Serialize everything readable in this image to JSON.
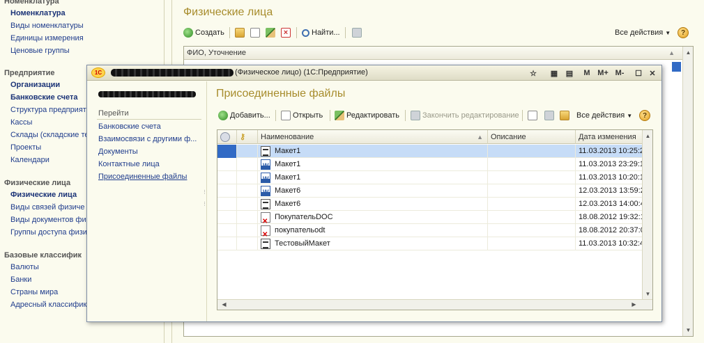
{
  "nav": {
    "groups": [
      {
        "title": "Номенклатура",
        "items": [
          {
            "label": "Номенклатура",
            "bold": true
          },
          {
            "label": "Виды номенклатуры"
          },
          {
            "label": "Единицы измерения"
          },
          {
            "label": "Ценовые группы"
          }
        ]
      },
      {
        "title": "Предприятие",
        "items": [
          {
            "label": "Организации",
            "bold": true
          },
          {
            "label": "Банковские счета",
            "bold": true
          },
          {
            "label": "Структура предприятия"
          },
          {
            "label": "Кассы"
          },
          {
            "label": "Склады (складские те"
          },
          {
            "label": "Проекты"
          },
          {
            "label": "Календари"
          }
        ]
      },
      {
        "title": "Физические лица",
        "items": [
          {
            "label": "Физические лица",
            "bold": true
          },
          {
            "label": "Виды связей физиче"
          },
          {
            "label": "Виды документов физ"
          },
          {
            "label": "Группы доступа физи"
          }
        ]
      },
      {
        "title": "Базовые классифик",
        "items": [
          {
            "label": "Валюты"
          },
          {
            "label": "Банки"
          },
          {
            "label": "Страны мира"
          },
          {
            "label": "Адресный классифик"
          }
        ]
      }
    ]
  },
  "main": {
    "title": "Физические лица",
    "toolbar": {
      "create": "Создать",
      "find": "Найти...",
      "all_actions": "Все действия",
      "help": "?"
    },
    "grid": {
      "column": "ФИО, Уточнение"
    }
  },
  "dialog": {
    "title": "(Физическое лицо) (1С:Предприятие)",
    "logo": "1С",
    "controls": {
      "m": "M",
      "m_plus": "M+",
      "m_minus": "M-"
    },
    "side": {
      "section": "Перейти",
      "links": [
        "Банковские счета",
        "Взаимосвязи с другими ф...",
        "Документы",
        "Контактные лица",
        "Присоединенные файлы"
      ]
    },
    "heading": "Присоединенные файлы",
    "toolbar": {
      "add": "Добавить...",
      "open": "Открыть",
      "edit": "Редактировать",
      "finish_edit": "Закончить редактирование",
      "all_actions": "Все действия",
      "help": "?"
    },
    "files": {
      "columns": {
        "name": "Наименование",
        "description": "Описание",
        "date": "Дата изменения"
      },
      "rows": [
        {
          "name": "Макет1",
          "icon": "maket-icon",
          "date": "11.03.2013 10:25:2",
          "selected": true
        },
        {
          "name": "Макет1",
          "icon": "word-icon",
          "date": "11.03.2013 23:29:1"
        },
        {
          "name": "Макет1",
          "icon": "word-icon",
          "date": "11.03.2013 10:20:1"
        },
        {
          "name": "Макет6",
          "icon": "word-icon",
          "date": "12.03.2013 13:59:2"
        },
        {
          "name": "Макет6",
          "icon": "maket-icon",
          "date": "12.03.2013 14:00:4"
        },
        {
          "name": "ПокупательDOC",
          "icon": "error-doc-icon",
          "date": "18.08.2012 19:32:1"
        },
        {
          "name": "покупательodt",
          "icon": "error-doc-icon",
          "date": "18.08.2012 20:37:0"
        },
        {
          "name": "ТестовыйМакет",
          "icon": "maket-icon",
          "date": "11.03.2013 10:32:4"
        }
      ]
    }
  },
  "colors": {
    "accent_title": "#a78c2c",
    "link": "#1f3c8c",
    "selection": "#c6dcf7",
    "row_indicator": "#316ac5"
  }
}
